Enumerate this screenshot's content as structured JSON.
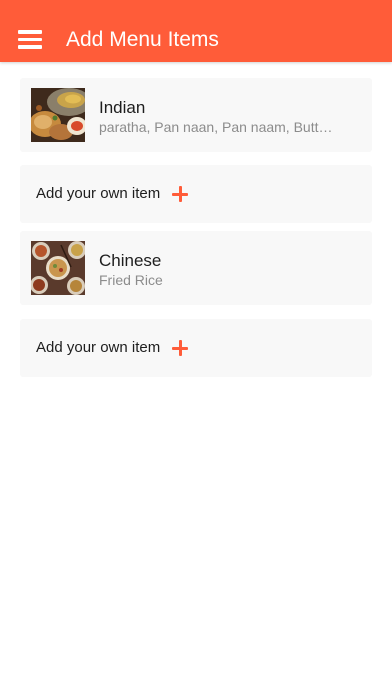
{
  "header": {
    "title": "Add Menu Items",
    "menu_icon": "hamburger-menu-icon"
  },
  "colors": {
    "accent": "#ff5c39",
    "card_background": "#f8f8f8"
  },
  "menu": {
    "categories": [
      {
        "name": "Indian",
        "items_summary": "paratha, Pan naan, Pan naam, Butter naan",
        "thumbnail": "indian-food-photo"
      },
      {
        "name": "Chinese",
        "items_summary": "Fried Rice",
        "thumbnail": "chinese-food-photo"
      }
    ],
    "add_item_label": "Add your own item",
    "add_icon": "plus-icon"
  }
}
